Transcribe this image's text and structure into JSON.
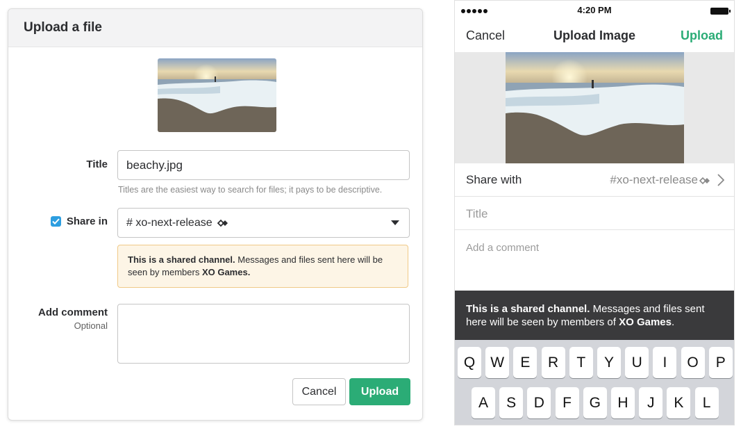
{
  "desktop": {
    "dialog_title": "Upload a file",
    "title_label": "Title",
    "title_value": "beachy.jpg",
    "title_hint": "Titles are the easiest way to search for files; it pays to be descriptive.",
    "share_label": "Share in",
    "share_checked": true,
    "share_channel": "# xo-next-release",
    "notice_bold": "This is a shared channel.",
    "notice_text": " Messages and files sent here will be seen by members ",
    "notice_org": "XO Games.",
    "comment_label": "Add comment",
    "comment_optional": "Optional",
    "comment_value": "",
    "cancel_label": "Cancel",
    "upload_label": "Upload"
  },
  "mobile": {
    "status_time": "4:20 PM",
    "nav_cancel": "Cancel",
    "nav_title": "Upload Image",
    "nav_upload": "Upload",
    "share_with_label": "Share with",
    "share_with_value": "#xo-next-release",
    "title_placeholder": "Title",
    "comment_placeholder": "Add a comment",
    "banner_bold": "This is a shared channel.",
    "banner_text": " Messages and files sent here will be seen by members of ",
    "banner_org": "XO Games",
    "banner_end": ".",
    "keyboard_row1": [
      "Q",
      "W",
      "E",
      "R",
      "T",
      "Y",
      "U",
      "I",
      "O",
      "P"
    ],
    "keyboard_row2": [
      "A",
      "S",
      "D",
      "F",
      "G",
      "H",
      "J",
      "K",
      "L"
    ]
  },
  "colors": {
    "accent_green": "#2bac76",
    "checkbox_blue": "#2d9ee0",
    "notice_bg": "#fdf5e6",
    "notice_border": "#f0c987",
    "banner_dark": "#3a3a3c"
  },
  "icons": [
    "shared-channel-icon",
    "chevron-down-icon",
    "chevron-right-icon",
    "checkmark-icon",
    "signal-icon",
    "battery-icon"
  ]
}
